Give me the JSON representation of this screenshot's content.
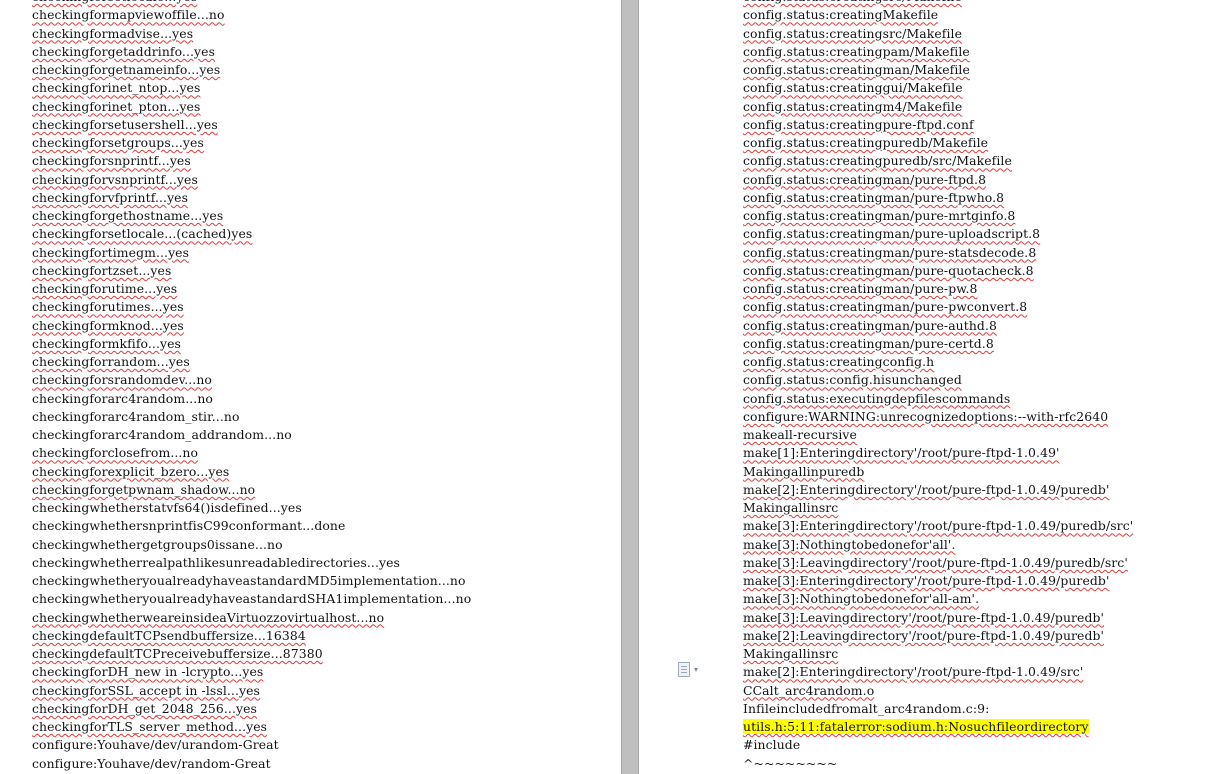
{
  "left_page": {
    "lines": [
      {
        "text": "checkingforsetlocale...yes",
        "style": "squiggle"
      },
      {
        "text": "checkingformapviewoffile...no",
        "style": "squiggle"
      },
      {
        "text": "checkingformadvise...yes",
        "style": "squiggle"
      },
      {
        "text": "checkingforgetaddrinfo...yes",
        "style": "squiggle"
      },
      {
        "text": "checkingforgetnameinfo...yes",
        "style": "squiggle"
      },
      {
        "text": "checkingforinet_ntop...yes",
        "style": "squiggle"
      },
      {
        "text": "checkingforinet_pton...yes",
        "style": "squiggle"
      },
      {
        "text": "checkingforsetusershell...yes",
        "style": "squiggle"
      },
      {
        "text": "checkingforsetgroups...yes",
        "style": "squiggle"
      },
      {
        "text": "checkingforsnprintf...yes",
        "style": "squiggle"
      },
      {
        "text": "checkingforvsnprintf...yes",
        "style": "squiggle"
      },
      {
        "text": "checkingforvfprintf...yes",
        "style": "squiggle"
      },
      {
        "text": "checkingforgethostname...yes",
        "style": "squiggle"
      },
      {
        "text": "checkingforsetlocale...(cached)yes",
        "style": "squiggle"
      },
      {
        "text": "checkingfortimegm...yes",
        "style": "squiggle"
      },
      {
        "text": "checkingfortzset...yes",
        "style": "squiggle"
      },
      {
        "text": "checkingforutime...yes",
        "style": "squiggle"
      },
      {
        "text": "checkingforutimes...yes",
        "style": "squiggle"
      },
      {
        "text": "checkingformknod...yes",
        "style": "squiggle"
      },
      {
        "text": "checkingformkfifo...yes",
        "style": "squiggle"
      },
      {
        "text": "checkingforrandom...yes",
        "style": "squiggle"
      },
      {
        "text": "checkingforsrandomdev...no",
        "style": "squiggle"
      },
      {
        "text": "checkingforarc4random...no",
        "style": "plain"
      },
      {
        "text": "checkingforarc4random_stir...no",
        "style": "plain"
      },
      {
        "text": "checkingforarc4random_addrandom...no",
        "style": "plain"
      },
      {
        "text": "checkingforclosefrom...no",
        "style": "squiggle"
      },
      {
        "text": "checkingforexplicit_bzero...yes",
        "style": "squiggle"
      },
      {
        "text": "checkingforgetpwnam_shadow...no",
        "style": "squiggle"
      },
      {
        "text": "checkingwhetherstatvfs64()isdefined...yes",
        "style": "plain"
      },
      {
        "text": "checkingwhethersnprintfisC99conformant...done",
        "style": "plain"
      },
      {
        "text": "checkingwhethergetgroups0issane...no",
        "style": "plain"
      },
      {
        "text": "checkingwhetherrealpathlikesunreadabledirectories...yes",
        "style": "plain"
      },
      {
        "text": "checkingwhetheryoualreadyhaveastandardMD5implementation...no",
        "style": "plain"
      },
      {
        "text": "checkingwhetheryoualreadyhaveastandardSHA1implementation...no",
        "style": "plain"
      },
      {
        "text": "checkingwhetherweareinsideaVirtuozzovirtualhost...no",
        "style": "squiggle"
      },
      {
        "text": "checkingdefaultTCPsendbuffersize...16384",
        "style": "squiggle"
      },
      {
        "text": "checkingdefaultTCPreceivebuffersize...87380",
        "style": "squiggle"
      },
      {
        "text": "checkingforDH_new in -lcrypto...yes",
        "style": "squiggle"
      },
      {
        "text": "checkingforSSL_accept in -lssl...yes",
        "style": "squiggle"
      },
      {
        "text": "checkingforDH_get_2048_256...yes",
        "style": "squiggle"
      },
      {
        "text": "checkingforTLS_server_method...yes",
        "style": "squiggle"
      },
      {
        "text": "configure:Youhave/dev/urandom-Great",
        "style": "plain"
      },
      {
        "text": "configure:Youhave/dev/random-Great",
        "style": "plain"
      }
    ]
  },
  "right_page": {
    "lines": [
      {
        "text": "config.status:creatingsrc/Makefile",
        "style": "squiggle"
      },
      {
        "text": "config.status:creatingMakefile",
        "style": "squiggle"
      },
      {
        "text": "config.status:creatingsrc/Makefile",
        "style": "squiggle"
      },
      {
        "text": "config.status:creatingpam/Makefile",
        "style": "squiggle"
      },
      {
        "text": "config.status:creatingman/Makefile",
        "style": "squiggle"
      },
      {
        "text": "config.status:creatinggui/Makefile",
        "style": "squiggle"
      },
      {
        "text": "config.status:creatingm4/Makefile",
        "style": "squiggle"
      },
      {
        "text": "config.status:creatingpure-ftpd.conf",
        "style": "squiggle"
      },
      {
        "text": "config.status:creatingpuredb/Makefile",
        "style": "squiggle"
      },
      {
        "text": "config.status:creatingpuredb/src/Makefile",
        "style": "squiggle"
      },
      {
        "text": "config.status:creatingman/pure-ftpd.8",
        "style": "squiggle"
      },
      {
        "text": "config.status:creatingman/pure-ftpwho.8",
        "style": "squiggle"
      },
      {
        "text": "config.status:creatingman/pure-mrtginfo.8",
        "style": "squiggle"
      },
      {
        "text": "config.status:creatingman/pure-uploadscript.8",
        "style": "squiggle"
      },
      {
        "text": "config.status:creatingman/pure-statsdecode.8",
        "style": "squiggle"
      },
      {
        "text": "config.status:creatingman/pure-quotacheck.8",
        "style": "squiggle"
      },
      {
        "text": "config.status:creatingman/pure-pw.8",
        "style": "squiggle"
      },
      {
        "text": "config.status:creatingman/pure-pwconvert.8",
        "style": "squiggle"
      },
      {
        "text": "config.status:creatingman/pure-authd.8",
        "style": "squiggle"
      },
      {
        "text": "config.status:creatingman/pure-certd.8",
        "style": "squiggle"
      },
      {
        "text": "config.status:creatingconfig.h",
        "style": "squiggle"
      },
      {
        "text": "config.status:config.hisunchanged",
        "style": "squiggle"
      },
      {
        "text": "config.status:executingdepfilescommands",
        "style": "squiggle"
      },
      {
        "text": "configure:WARNING:unrecognizedoptions:--with-rfc2640",
        "style": "squiggle"
      },
      {
        "text": "makeall-recursive",
        "style": "squiggle"
      },
      {
        "text": "make[1]:Enteringdirectory'/root/pure-ftpd-1.0.49'",
        "style": "squiggle"
      },
      {
        "text": "Makingallinpuredb",
        "style": "squiggle"
      },
      {
        "text": "make[2]:Enteringdirectory'/root/pure-ftpd-1.0.49/puredb'",
        "style": "squiggle"
      },
      {
        "text": "Makingallinsrc",
        "style": "squiggle"
      },
      {
        "text": "make[3]:Enteringdirectory'/root/pure-ftpd-1.0.49/puredb/src'",
        "style": "squiggle"
      },
      {
        "text": "make[3]:Nothingtobedonefor'all'.",
        "style": "squiggle"
      },
      {
        "text": "make[3]:Leavingdirectory'/root/pure-ftpd-1.0.49/puredb/src'",
        "style": "squiggle"
      },
      {
        "text": "make[3]:Enteringdirectory'/root/pure-ftpd-1.0.49/puredb'",
        "style": "squiggle"
      },
      {
        "text": "make[3]:Nothingtobedonefor'all-am'.",
        "style": "squiggle"
      },
      {
        "text": "make[3]:Leavingdirectory'/root/pure-ftpd-1.0.49/puredb'",
        "style": "squiggle"
      },
      {
        "text": "make[2]:Leavingdirectory'/root/pure-ftpd-1.0.49/puredb'",
        "style": "squiggle"
      },
      {
        "text": "Makingallinsrc",
        "style": "squiggle"
      },
      {
        "text": "make[2]:Enteringdirectory'/root/pure-ftpd-1.0.49/src'",
        "style": "squiggle"
      },
      {
        "text": "CCalt_arc4random.o",
        "style": "squiggle"
      },
      {
        "text": "Infileincludedfromalt_arc4random.c:9:",
        "style": "plain"
      },
      {
        "text": "utils.h:5:11:fatalerror:sodium.h:Nosuchfileordirectory",
        "style": "highlight"
      },
      {
        "text": "#include",
        "style": "plain"
      },
      {
        "text": "^~~~~~~~~",
        "style": "plain"
      }
    ]
  },
  "paste_options": {
    "icon": "clipboard-icon",
    "caret": "▾"
  }
}
